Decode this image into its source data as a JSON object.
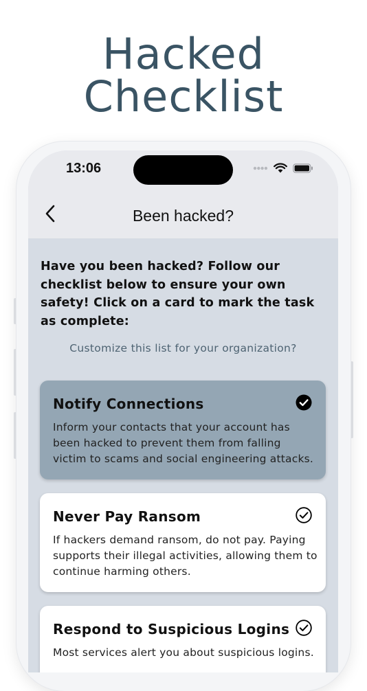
{
  "promo": {
    "title_line1": "Hacked",
    "title_line2": "Checklist"
  },
  "status_bar": {
    "time": "13:06"
  },
  "nav": {
    "title": "Been hacked?"
  },
  "intro_text": "Have you been hacked? Follow our checklist below to ensure your own safety! Click on a card to mark the task as complete:",
  "customize_link": "Customize this list for your organization?",
  "cards": [
    {
      "title": "Notify Connections",
      "description": "Inform your contacts that your account has been hacked to prevent them from falling victim to scams and social engineering attacks.",
      "completed": true
    },
    {
      "title": "Never Pay Ransom",
      "description": "If hackers demand ransom, do not pay. Paying supports their illegal activities, allowing them to continue harming others.",
      "completed": false
    },
    {
      "title": "Respond to Suspicious Logins",
      "description": "Most services alert you about suspicious logins.",
      "completed": false
    }
  ],
  "colors": {
    "accent": "#3a5464",
    "completed_card": "#94a6b4",
    "background": "#d6dce4"
  }
}
